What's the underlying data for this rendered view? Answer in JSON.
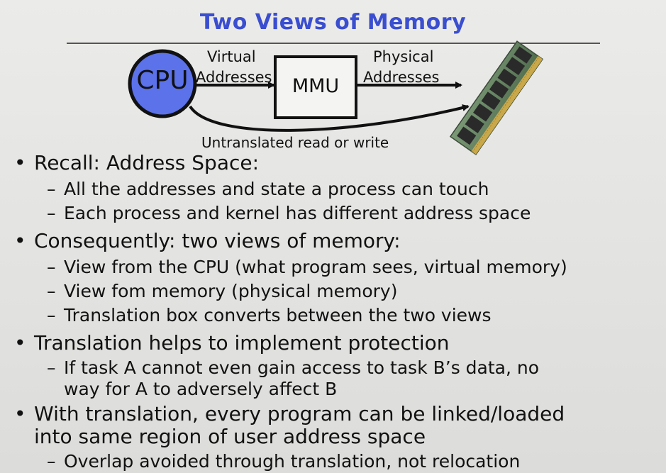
{
  "slide": {
    "title": "Two Views of Memory",
    "diagram": {
      "cpu_label": "CPU",
      "mmu_label": "MMU",
      "virtual_line1": "Virtual",
      "virtual_line2": "Addresses",
      "physical_line1": "Physical",
      "physical_line2": "Addresses",
      "untranslated": "Untranslated read or write",
      "cpu_color": "#5b72ea",
      "memory_icon": "memory-module-icon"
    },
    "bullets": [
      {
        "text": "Recall: Address Space:",
        "subs": [
          "All the addresses and state a process can touch",
          "Each process and kernel has different address space"
        ]
      },
      {
        "text": "Consequently: two views of memory:",
        "subs": [
          "View from the CPU (what program sees, virtual memory)",
          "View fom memory (physical memory)",
          "Translation box converts between the two views"
        ]
      },
      {
        "text": "Translation helps to implement protection",
        "subs": [
          "If task A cannot even gain access to task B’s data, no",
          "way for A to adversely affect B"
        ]
      },
      {
        "text": "With translation, every program can be linked/loaded",
        "text2": "into same region of user address space",
        "subs": [
          "Overlap avoided through translation, not relocation"
        ]
      }
    ],
    "bullet_glyph": "•",
    "dash_glyph": "–"
  }
}
